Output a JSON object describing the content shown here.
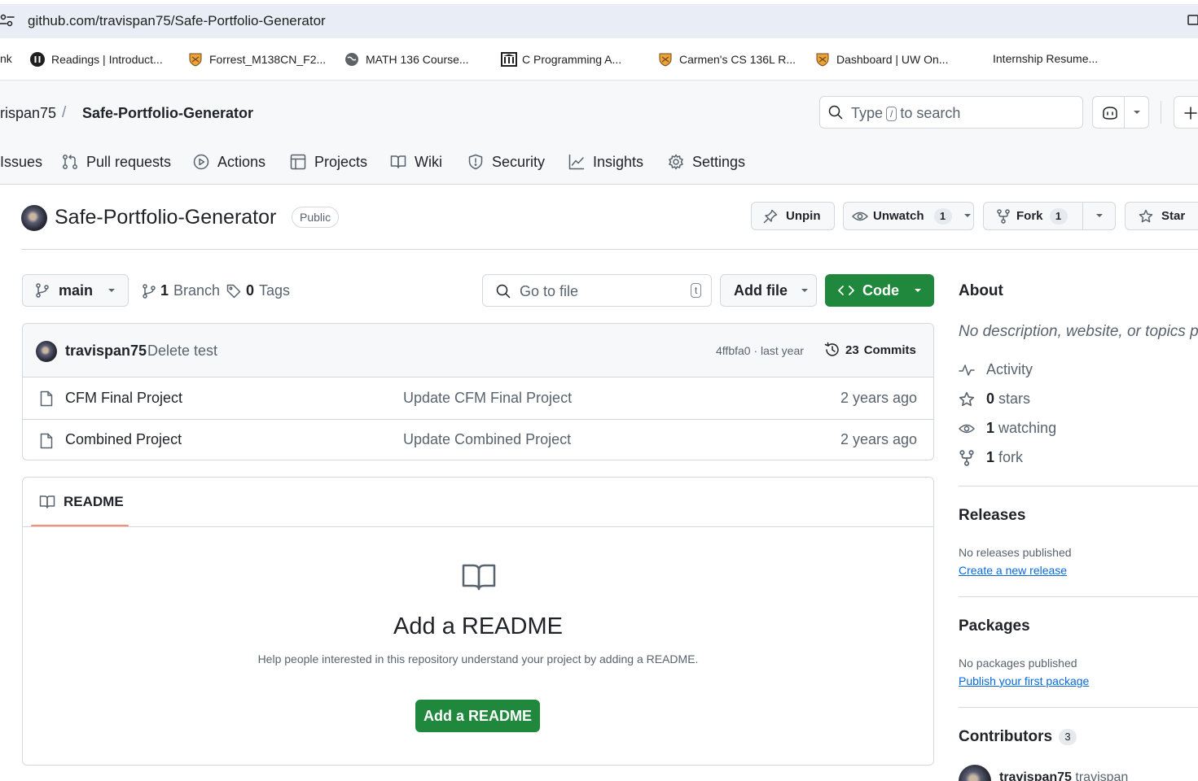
{
  "browser": {
    "url": "github.com/travispan75/Safe-Portfolio-Generator",
    "bookmarks": [
      {
        "label": "nk",
        "icon": "none"
      },
      {
        "label": "Readings | Introduct...",
        "icon": "pause-circle-icon"
      },
      {
        "label": "Forrest_M138CN_F2...",
        "icon": "shield-crest-icon"
      },
      {
        "label": "MATH 136 Course...",
        "icon": "globe-icon"
      },
      {
        "label": "C Programming A...",
        "icon": "building-icon"
      },
      {
        "label": "Carmen's CS 136L R...",
        "icon": "shield-crest-icon"
      },
      {
        "label": "Dashboard | UW On...",
        "icon": "shield-crest-icon"
      },
      {
        "label": "Internship Resume...",
        "icon": "none"
      }
    ]
  },
  "header": {
    "owner": "rispan75",
    "separator": "/",
    "repo": "Safe-Portfolio-Generator",
    "search_pre": "Type",
    "search_key": "/",
    "search_post": "to search"
  },
  "tabs": [
    {
      "label": "Issues",
      "icon": "issue-icon"
    },
    {
      "label": "Pull requests",
      "icon": "pull-request-icon"
    },
    {
      "label": "Actions",
      "icon": "play-icon"
    },
    {
      "label": "Projects",
      "icon": "table-icon"
    },
    {
      "label": "Wiki",
      "icon": "book-icon"
    },
    {
      "label": "Security",
      "icon": "shield-icon"
    },
    {
      "label": "Insights",
      "icon": "graph-icon"
    },
    {
      "label": "Settings",
      "icon": "gear-icon"
    }
  ],
  "repo": {
    "title": "Safe-Portfolio-Generator",
    "visibility": "Public",
    "unpin": "Unpin",
    "unwatch": "Unwatch",
    "watch_count": "1",
    "fork": "Fork",
    "fork_count": "1",
    "star": "Star"
  },
  "branch_bar": {
    "branch": "main",
    "branches_count": "1",
    "branches_label": "Branch",
    "tags_count": "0",
    "tags_label": "Tags",
    "goto_placeholder": "Go to file",
    "goto_key": "t",
    "add_file": "Add file",
    "code": "Code"
  },
  "latest_commit": {
    "author": "travispan75",
    "message": "Delete test",
    "hash_time": "4ffbfa0 · last year",
    "commits_count": "23",
    "commits_label": "Commits"
  },
  "files": [
    {
      "name": "CFM Final Project",
      "message": "Update CFM Final Project",
      "time": "2 years ago"
    },
    {
      "name": "Combined Project",
      "message": "Update Combined Project",
      "time": "2 years ago"
    }
  ],
  "readme": {
    "tab": "README",
    "heading": "Add a README",
    "description": "Help people interested in this repository understand your project by adding a README.",
    "button": "Add a README"
  },
  "sidebar": {
    "about": "About",
    "no_description": "No description, website, or topics p",
    "activity": "Activity",
    "stars_count": "0",
    "stars_label": "stars",
    "watching_count": "1",
    "watching_label": "watching",
    "forks_count": "1",
    "forks_label": "fork",
    "releases": "Releases",
    "no_releases": "No releases published",
    "create_release": "Create a new release",
    "packages": "Packages",
    "no_packages": "No packages published",
    "publish_package": "Publish your first package",
    "contributors": "Contributors",
    "contributors_count": "3",
    "contributor_name": "travispan75",
    "contributor_handle": "travispan"
  },
  "colors": {
    "primary_green": "#1f883d",
    "link_blue": "#0969da",
    "tab_underline": "#fd8c73",
    "muted_text": "#59636e"
  }
}
